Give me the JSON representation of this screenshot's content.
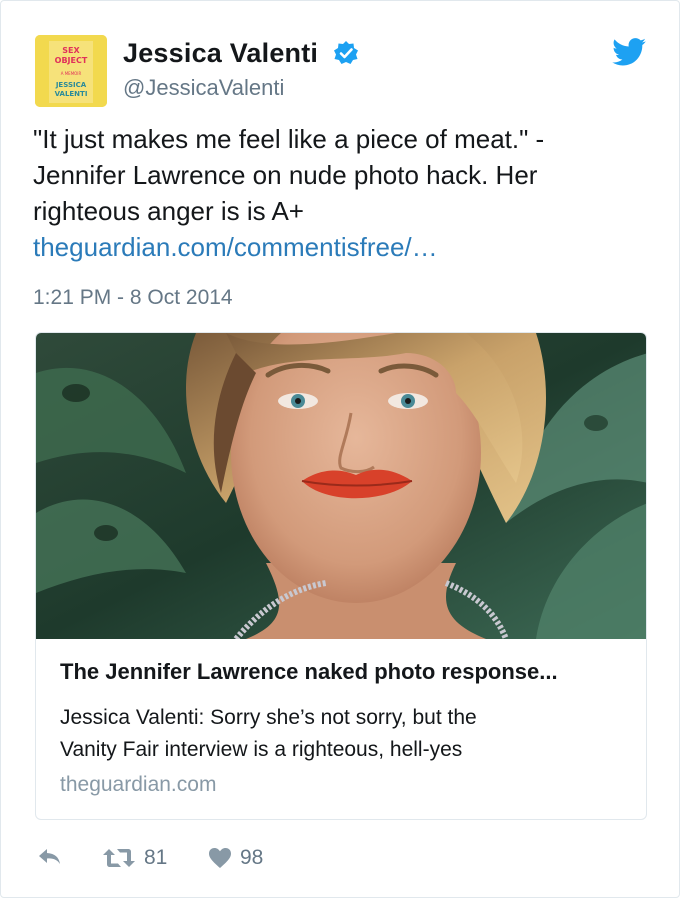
{
  "author": {
    "name": "Jessica Valenti",
    "handle": "@JessicaValenti",
    "verified": true,
    "avatar_lines": [
      "SEX",
      "OBJECT",
      "A MEMOIR",
      "JESSICA",
      "VALENTI"
    ]
  },
  "tweet": {
    "text_lines": [
      "\"It just makes me feel like a piece of meat.\" -",
      "Jennifer Lawrence on nude photo hack. Her",
      "righteous anger is is A+"
    ],
    "link": "theguardian.com/commentisfree/…",
    "timestamp": "1:21 PM - 8 Oct 2014"
  },
  "card": {
    "title": "The Jennifer Lawrence naked photo response...",
    "description_lines": [
      "Jessica Valenti: Sorry she’s not sorry, but the",
      "Vanity Fair interview is a righteous, hell-yes"
    ],
    "domain": "theguardian.com"
  },
  "actions": {
    "retweets": "81",
    "likes": "98"
  },
  "colors": {
    "link": "#2b7bb9",
    "twitter_blue": "#1da1f2",
    "muted": "#657786",
    "border": "#e1e8ed"
  },
  "icons": [
    "twitter-bird-icon",
    "verified-badge-icon",
    "reply-icon",
    "retweet-icon",
    "heart-icon"
  ]
}
